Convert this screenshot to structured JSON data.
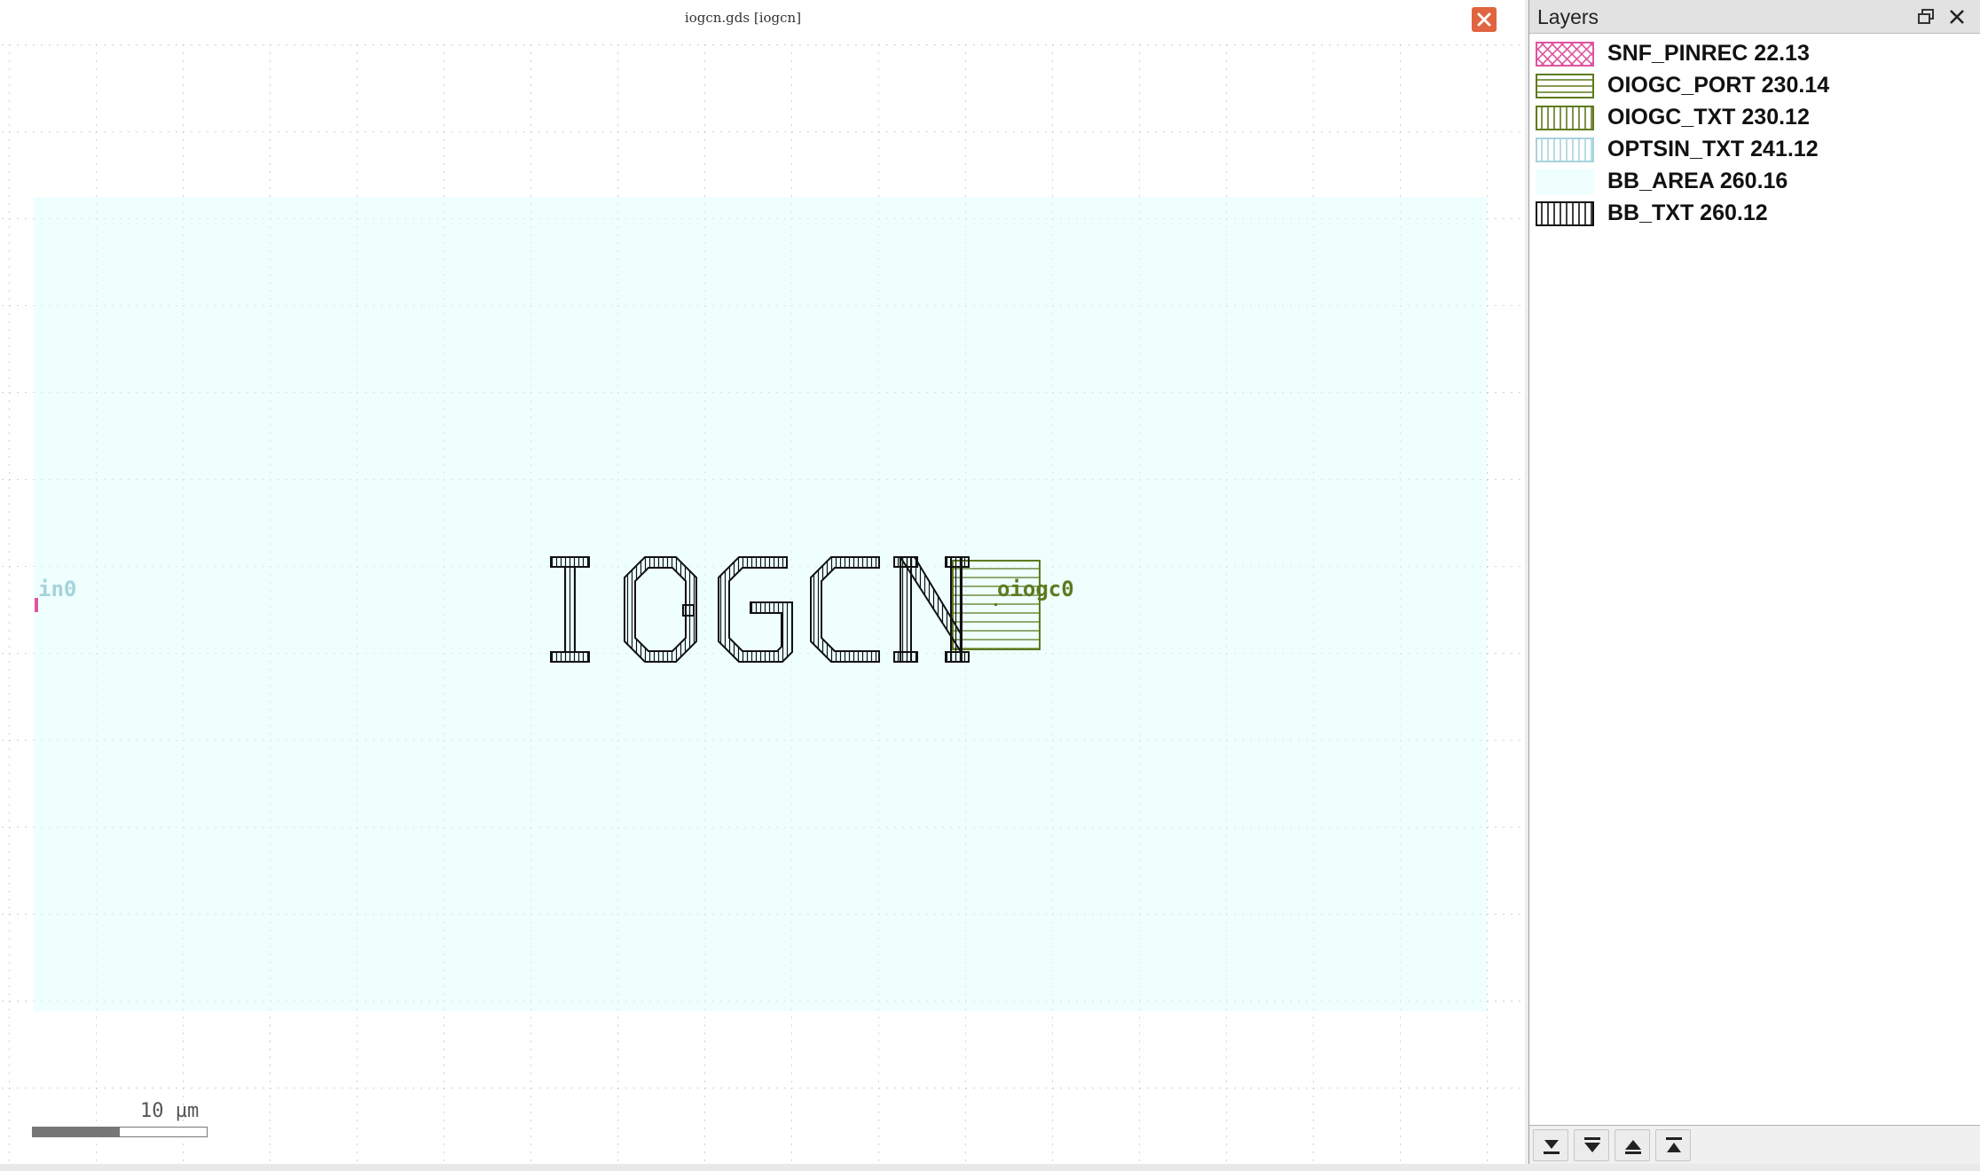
{
  "viewer": {
    "tab_title": "iogcn.gds [iogcn]",
    "scale_label": "10 µm",
    "scale_fill_fraction": 0.5,
    "close_icon": "close-icon"
  },
  "layout": {
    "cell_text": "IOGCN",
    "port_label_in": "in0",
    "port_label_out": "oiogc0"
  },
  "colors": {
    "bb_area": "#eefffe",
    "pinrec": "#e0549f",
    "oiogc": "#5e7a1f",
    "optsin": "#a6d2dc",
    "bb_txt": "#111111",
    "close_button": "#e0643f"
  },
  "layers_panel": {
    "title": "Layers",
    "float_icon": "restore-window-icon",
    "close_icon": "close-icon",
    "items": [
      {
        "label": "SNF_PINREC 22.13",
        "pattern": "crosshatch",
        "color": "#e0549f"
      },
      {
        "label": "OIOGC_PORT 230.14",
        "pattern": "horizontal",
        "color": "#5e7a1f"
      },
      {
        "label": "OIOGC_TXT 230.12",
        "pattern": "vertical",
        "color": "#5e7a1f"
      },
      {
        "label": "OPTSIN_TXT 241.12",
        "pattern": "vertical",
        "color": "#a6d2dc"
      },
      {
        "label": "BB_AREA 260.16",
        "pattern": "solid",
        "color": "#eefffe"
      },
      {
        "label": "BB_TXT 260.12",
        "pattern": "vertical",
        "color": "#111111"
      }
    ],
    "footer_buttons": [
      "move-to-bottom-icon",
      "move-down-icon",
      "move-up-icon",
      "move-to-top-icon"
    ]
  }
}
